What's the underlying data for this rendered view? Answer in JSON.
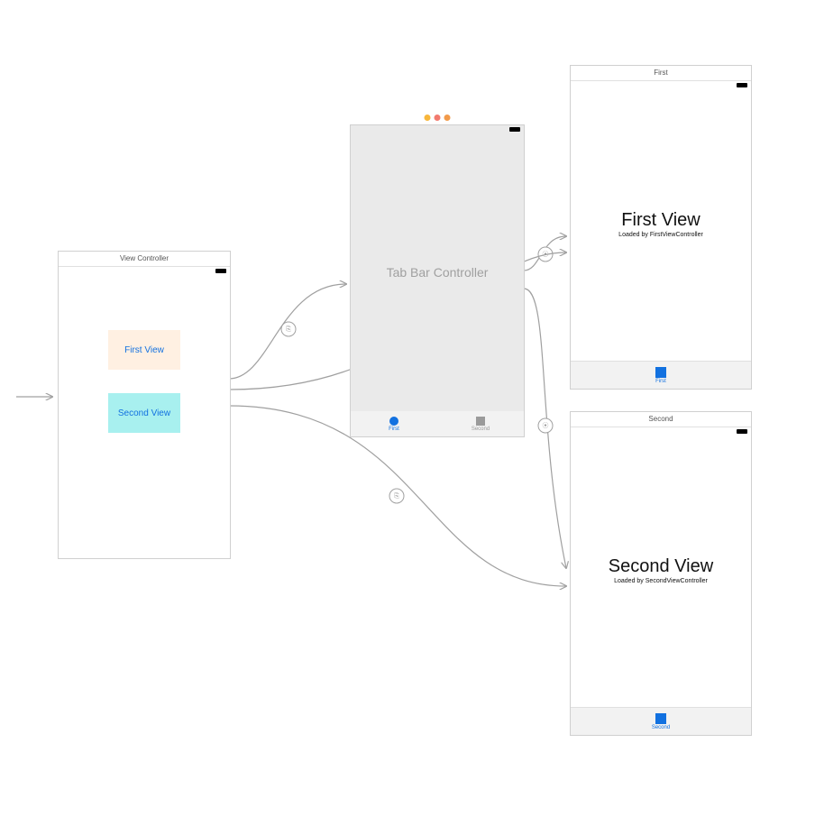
{
  "initial_vc": {
    "title": "View Controller",
    "button1_label": "First View",
    "button2_label": "Second View"
  },
  "tab_bar_controller": {
    "label": "Tab Bar Controller",
    "tabs": [
      {
        "label": "First",
        "selected": true
      },
      {
        "label": "Second",
        "selected": false
      }
    ]
  },
  "first_scene": {
    "title": "First",
    "heading": "First View",
    "subheading": "Loaded by FirstViewController",
    "tab_label": "First"
  },
  "second_scene": {
    "title": "Second",
    "heading": "Second View",
    "subheading": "Loaded by SecondViewController",
    "tab_label": "Second"
  }
}
